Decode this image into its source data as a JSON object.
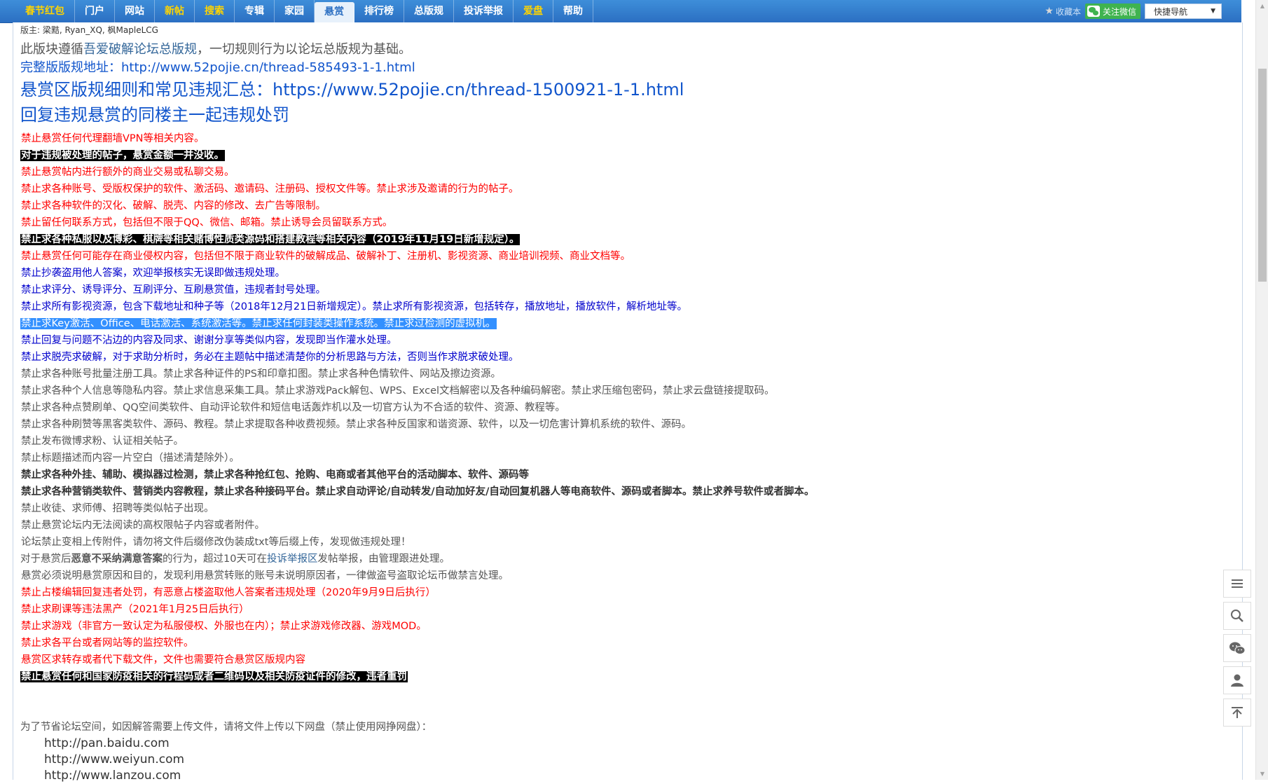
{
  "nav": {
    "items": [
      {
        "label": "春节红包",
        "style": "yellow"
      },
      {
        "label": "门户",
        "style": ""
      },
      {
        "label": "网站",
        "style": ""
      },
      {
        "label": "新帖",
        "style": "yellow"
      },
      {
        "label": "搜索",
        "style": "yellow"
      },
      {
        "label": "专辑",
        "style": ""
      },
      {
        "label": "家园",
        "style": ""
      },
      {
        "label": "悬赏",
        "style": "active"
      },
      {
        "label": "排行榜",
        "style": ""
      },
      {
        "label": "总版规",
        "style": ""
      },
      {
        "label": "投诉举报",
        "style": ""
      },
      {
        "label": "爱盘",
        "style": "yellow"
      },
      {
        "label": "帮助",
        "style": ""
      }
    ],
    "favorite_label": "收藏本",
    "wechat_label": "关注微信",
    "quick_nav_label": "快捷导航"
  },
  "moderators": {
    "prefix": "版主:",
    "names": "梁黠, Ryan_XQ, 枫MapleLCG"
  },
  "intro": {
    "line1_pre": "此版块遵循",
    "line1_link": "吾爱破解论坛总版规",
    "line1_post": "，一切规则行为以论坛总版规为基础。",
    "line2_label": "完整版版规地址：",
    "line2_url": "http://www.52pojie.cn/thread-585493-1-1.html",
    "line3": "悬赏区版规细则和常见违规汇总：https://www.52pojie.cn/thread-1500921-1-1.html",
    "line4": "回复违规悬赏的同楼主一起违规处罚"
  },
  "rules": [
    {
      "text": "禁止悬赏任何代理翻墙VPN等相关内容。",
      "style": "red"
    },
    {
      "text": "对于违规被处理的帖子，悬赏金额一并没收。",
      "style": "black"
    },
    {
      "text": "禁止悬赏帖内进行额外的商业交易或私聊交易。",
      "style": "red"
    },
    {
      "text": "禁止求各种账号、受版权保护的软件、激活码、邀请码、注册码、授权文件等。禁止求涉及邀请的行为的帖子。",
      "style": "red"
    },
    {
      "text": "禁止求各种软件的汉化、破解、脱壳、内容的修改、去广告等限制。",
      "style": "red"
    },
    {
      "text": "禁止留任何联系方式，包括但不限于QQ、微信、邮箱。禁止诱导会员留联系方式。",
      "style": "red"
    },
    {
      "text": "禁止求各种私服以及博彩、棋牌等相关赌博性质类源码和搭建教程等相关内容（2019年11月19日新增规定）。",
      "style": "black"
    },
    {
      "text": "禁止悬赏任何可能存在商业侵权内容，包括但不限于商业软件的破解成品、破解补丁、注册机、影视资源、商业培训视频、商业文档等。",
      "style": "red"
    },
    {
      "text": "禁止抄袭盗用他人答案，欢迎举报核实无误即做违规处理。",
      "style": "blue"
    },
    {
      "text": "禁止求评分、诱导评分、互刷评分、互刷悬赏值，违规者封号处理。",
      "style": "blue"
    },
    {
      "text": "禁止求所有影视资源，包含下载地址和种子等（2018年12月21日新增规定）。禁止求所有影视资源，包括转存，播放地址，播放软件，解析地址等。",
      "style": "blue"
    },
    {
      "text": "禁止求Key激活、Office、电话激活、系统激活等。禁止求任何封装类操作系统。禁止求过检测的虚拟机。",
      "style": "selected"
    },
    {
      "text": "禁止回复与问题不沾边的内容及同求、谢谢分享等类似内容，发现即当作灌水处理。",
      "style": "blue"
    },
    {
      "text": "禁止求脱壳求破解，对于求助分析时，务必在主题帖中描述清楚你的分析思路与方法，否则当作求脱求破处理。",
      "style": "blue"
    },
    {
      "text": "禁止求各种账号批量注册工具。禁止求各种证件的PS和印章扣图。禁止求各种色情软件、网站及擦边资源。",
      "style": "gray"
    },
    {
      "text": "禁止求各种个人信息等隐私内容。禁止求信息采集工具。禁止求游戏Pack解包、WPS、Excel文档解密以及各种编码解密。禁止求压缩包密码，禁止求云盘链接提取码。",
      "style": "gray"
    },
    {
      "text": "禁止求各种点赞刷单、QQ空间类软件、自动评论软件和短信电话轰炸机以及一切官方认为不合适的软件、资源、教程等。",
      "style": "gray"
    },
    {
      "text": "禁止求各种刷赞等黑客类软件、源码、教程。禁止求提取各种收费视频。禁止求各种反国家和谐资源、软件，以及一切危害计算机系统的软件、源码。",
      "style": "gray"
    },
    {
      "text": "禁止发布微博求粉、认证相关帖子。",
      "style": "gray"
    },
    {
      "text": "禁止标题描述而内容一片空白（描述清楚除外）。",
      "style": "gray"
    },
    {
      "text": "禁止求各种外挂、辅助、模拟器过检测，禁止求各种抢红包、抢购、电商或者其他平台的活动脚本、软件、源码等",
      "style": "dark"
    },
    {
      "text": "禁止求各种营销类软件、营销类内容教程，禁止求各种接码平台。禁止求自动评论/自动转发/自动加好友/自动回复机器人等电商软件、源码或者脚本。禁止求养号软件或者脚本。",
      "style": "dark"
    },
    {
      "text": "禁止收徒、求师傅、招聘等类似帖子出现。",
      "style": "gray"
    },
    {
      "text": "禁止悬赏论坛内无法阅读的高权限帖子内容或者附件。",
      "style": "gray"
    },
    {
      "text": "论坛禁止变相上传附件，请勿将文件后缀修改伪装成txt等后缀上传，发现做违规处理！",
      "style": "gray"
    }
  ],
  "special_rule": {
    "pre": "对于悬赏后",
    "bold": "恶意不采纳满意答案",
    "mid": "的行为，超过10天可在",
    "link": "投诉举报区",
    "post": "发帖举报，由管理跟进处理。"
  },
  "rules2": [
    {
      "text": "悬赏必须说明悬赏原因和目的，发现利用悬赏转账的账号未说明原因者，一律做盗号盗取论坛币做禁言处理。",
      "style": "gray"
    },
    {
      "text": "禁止占楼编辑回复违者处罚，有恶意占楼盗取他人答案者违规处理（2020年9月9日后执行）",
      "style": "red"
    },
    {
      "text": "禁止求刷课等违法黑产（2021年1月25日后执行）",
      "style": "red"
    },
    {
      "text": "禁止求游戏（非官方一致认定为私服侵权、外服也在内）；禁止求游戏修改器、游戏MOD。",
      "style": "red"
    },
    {
      "text": "禁止求各平台或者网站等的监控软件。",
      "style": "red"
    },
    {
      "text": "悬赏区求转存或者代下载文件，文件也需要符合悬赏区版规内容",
      "style": "red"
    },
    {
      "text": "禁止悬赏任何和国家防疫相关的行程码或者二维码以及相关防疫证件的修改，违者重罚",
      "style": "black"
    }
  ],
  "upload_note": "为了节省论坛空间，如因解答需要上传文件，请将文件上传以下网盘（禁止使用网挣网盘）：",
  "disks": [
    "http://pan.baidu.com",
    "http://www.weiyun.com",
    "http://www.lanzou.com"
  ],
  "side_tools": [
    {
      "name": "menu-icon"
    },
    {
      "name": "search-icon"
    },
    {
      "name": "wechat-icon"
    },
    {
      "name": "user-icon"
    },
    {
      "name": "back-to-top-icon"
    }
  ]
}
